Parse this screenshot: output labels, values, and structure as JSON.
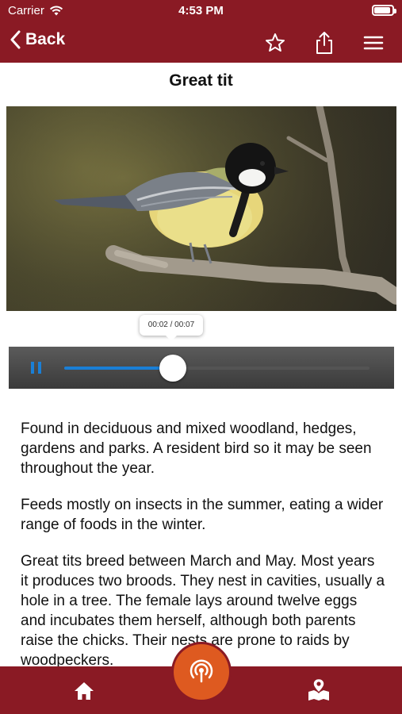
{
  "status_bar": {
    "carrier": "Carrier",
    "time": "4:53 PM"
  },
  "nav": {
    "back_label": "Back",
    "icons": [
      "star-icon",
      "share-icon",
      "menu-icon"
    ]
  },
  "page": {
    "title": "Great tit"
  },
  "audio": {
    "time_display": "00:02 / 00:07",
    "progress": 0.357
  },
  "body": {
    "paragraphs": [
      "Found in deciduous and mixed woodland, hedges, gardens and parks. A resident bird so it may be seen throughout the year.",
      "Feeds mostly on insects in the summer, eating a wider range of foods in the winter.",
      "Great tits breed between March and May. Most years it produces two broods. They nest in cavities, usually a hole in a tree. The female lays around twelve eggs and incubates them herself, although both parents raise the chicks. Their nests are prone to raids by woodpeckers."
    ]
  },
  "tab_bar": {
    "icons": [
      "home-icon",
      "listen-icon",
      "map-icon"
    ]
  },
  "colors": {
    "brand": "#8a1a24",
    "accent": "#de5a20",
    "progress": "#1a7fd6"
  }
}
